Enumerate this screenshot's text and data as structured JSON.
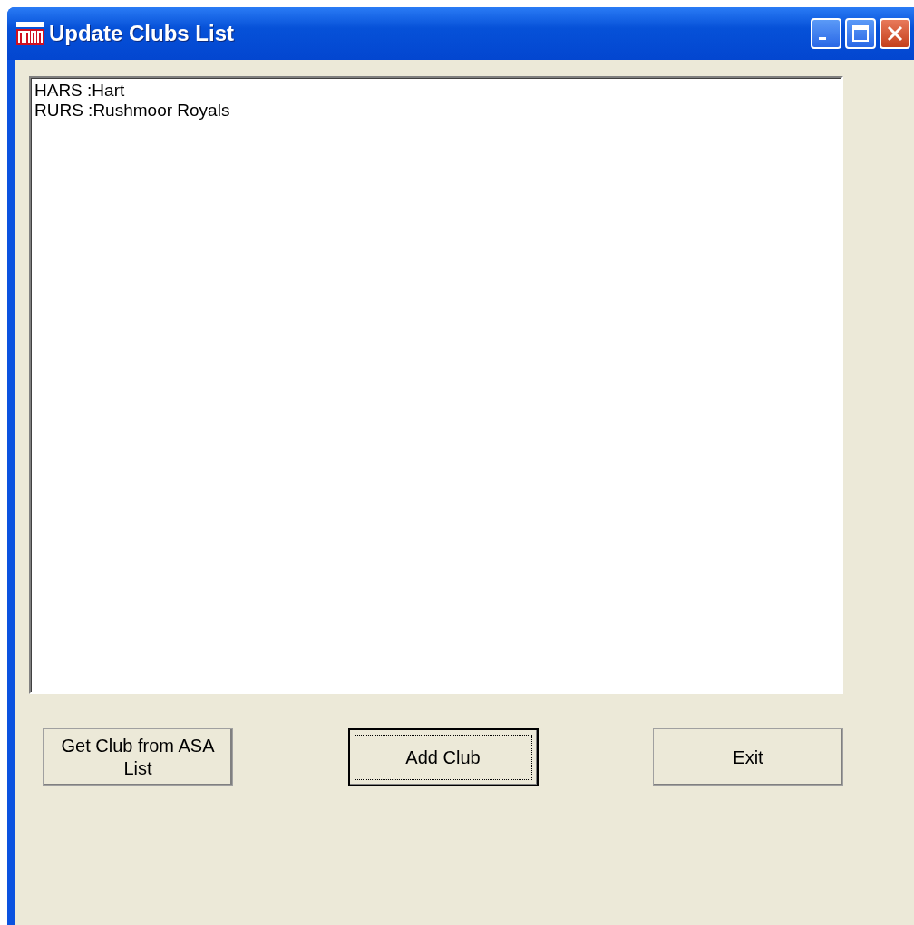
{
  "window": {
    "title": "Update Clubs List"
  },
  "list": {
    "items": [
      {
        "text": "HARS :Hart",
        "selected": false
      },
      {
        "text": "RURS :Rushmoor Royals",
        "selected": false
      }
    ]
  },
  "buttons": [
    {
      "label": "Get Club from ASA List",
      "focused": false
    },
    {
      "label": "Add Club",
      "focused": true
    },
    {
      "label": "Exit",
      "focused": false
    }
  ]
}
